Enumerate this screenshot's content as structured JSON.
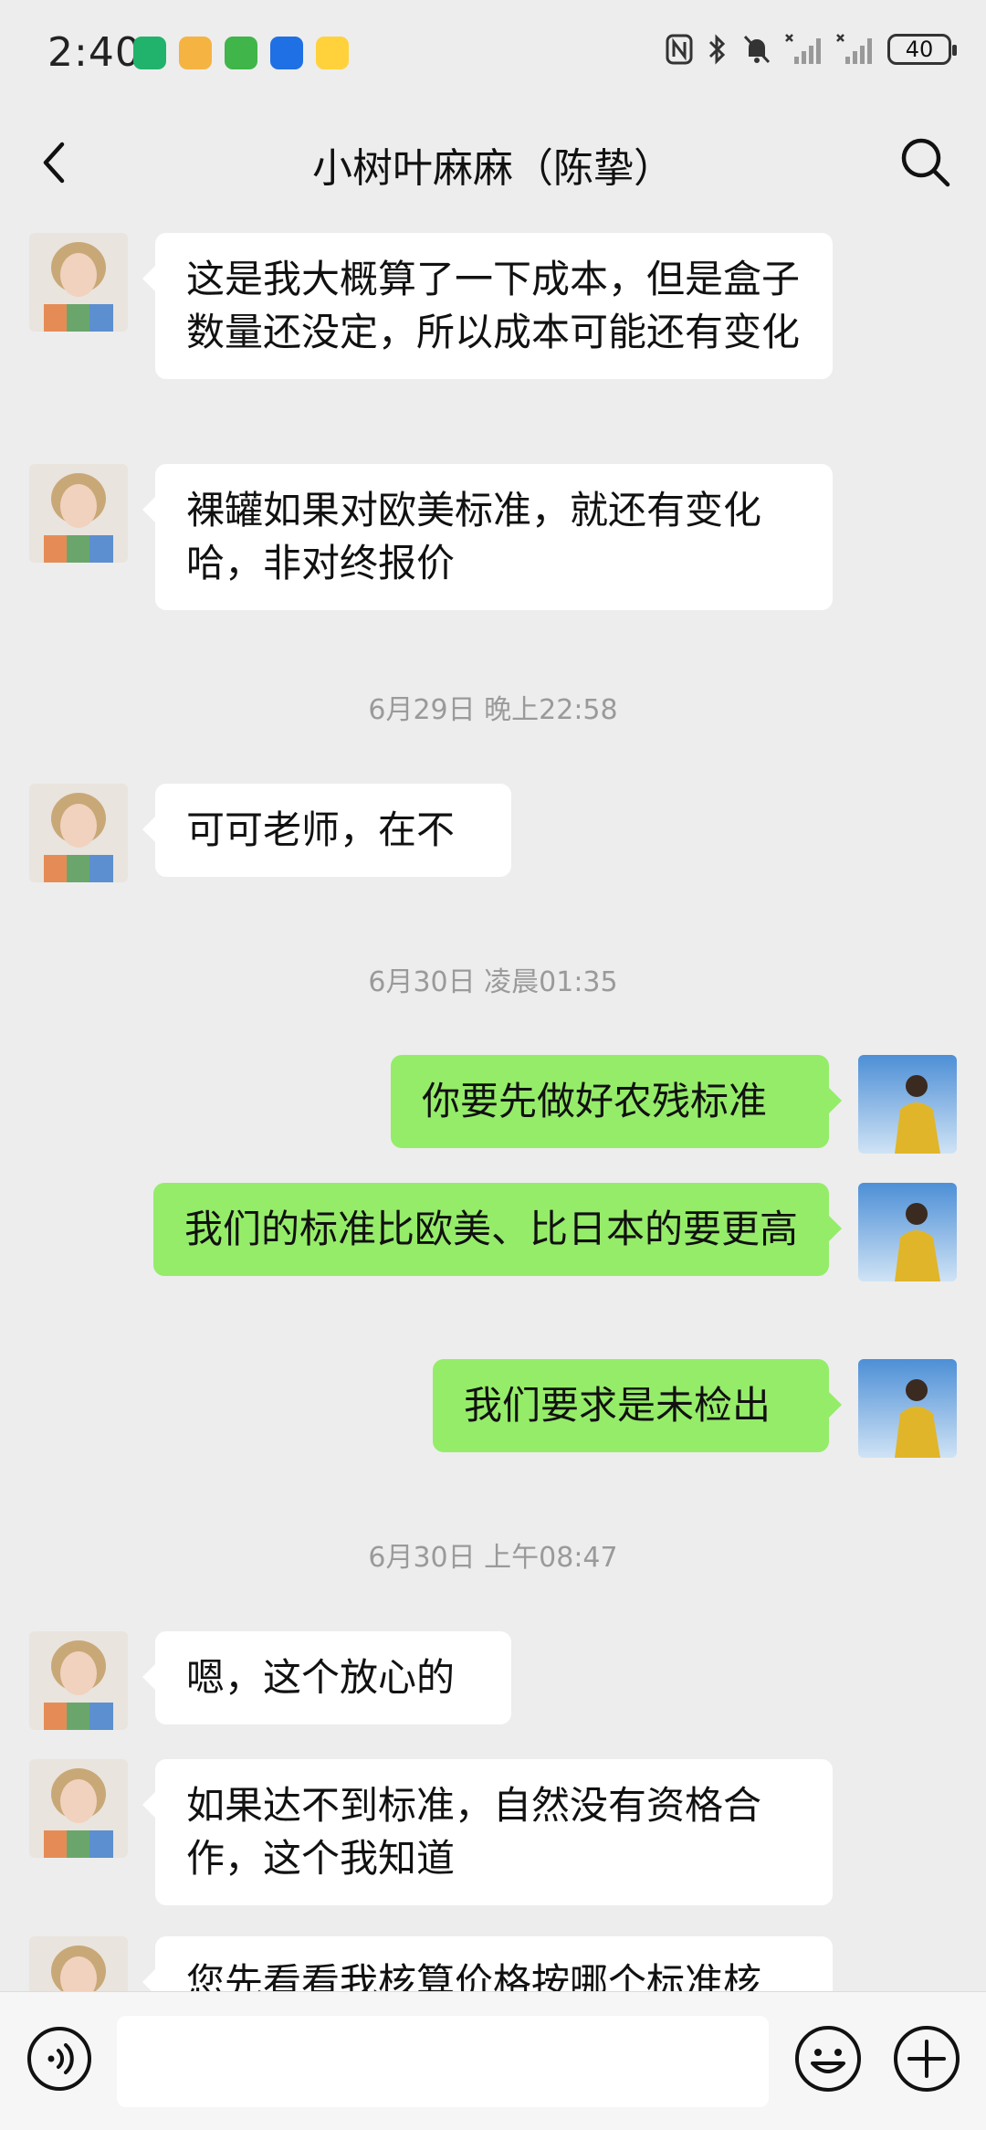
{
  "status_bar": {
    "time": "2:40",
    "battery": "40",
    "app_icons": [
      "leaf-app-icon",
      "mascot-app-icon",
      "green-app-icon",
      "flight-app-icon",
      "duck-app-icon"
    ]
  },
  "header": {
    "title": "小树叶麻麻（陈挚）"
  },
  "messages": [
    {
      "side": "left",
      "text": "这是我大概算了一下成本，但是盒子数量还没定，所以成本可能还有变化"
    },
    {
      "side": "left",
      "text": "裸罐如果对欧美标准，就还有变化哈，非对终报价"
    },
    {
      "timestamp": "6月29日 晚上22:58"
    },
    {
      "side": "left",
      "text": "可可老师，在不"
    },
    {
      "timestamp": "6月30日 凌晨01:35"
    },
    {
      "side": "right",
      "text": "你要先做好农残标准"
    },
    {
      "side": "right",
      "text": "我们的标准比欧美、比日本的要更高"
    },
    {
      "side": "right",
      "text": "我们要求是未检出"
    },
    {
      "timestamp": "6月30日 上午08:47"
    },
    {
      "side": "left",
      "text": "嗯，这个放心的"
    },
    {
      "side": "left",
      "text": "如果达不到标准，自然没有资格合作，这个我知道"
    },
    {
      "side": "left",
      "text": "您先看看我核算价格按哪个标准核"
    }
  ],
  "colors": {
    "background": "#ededed",
    "sent_bubble": "#95ec69",
    "received_bubble": "#ffffff",
    "timestamp_text": "#9a9a9a"
  },
  "input_bar": {
    "placeholder": ""
  }
}
